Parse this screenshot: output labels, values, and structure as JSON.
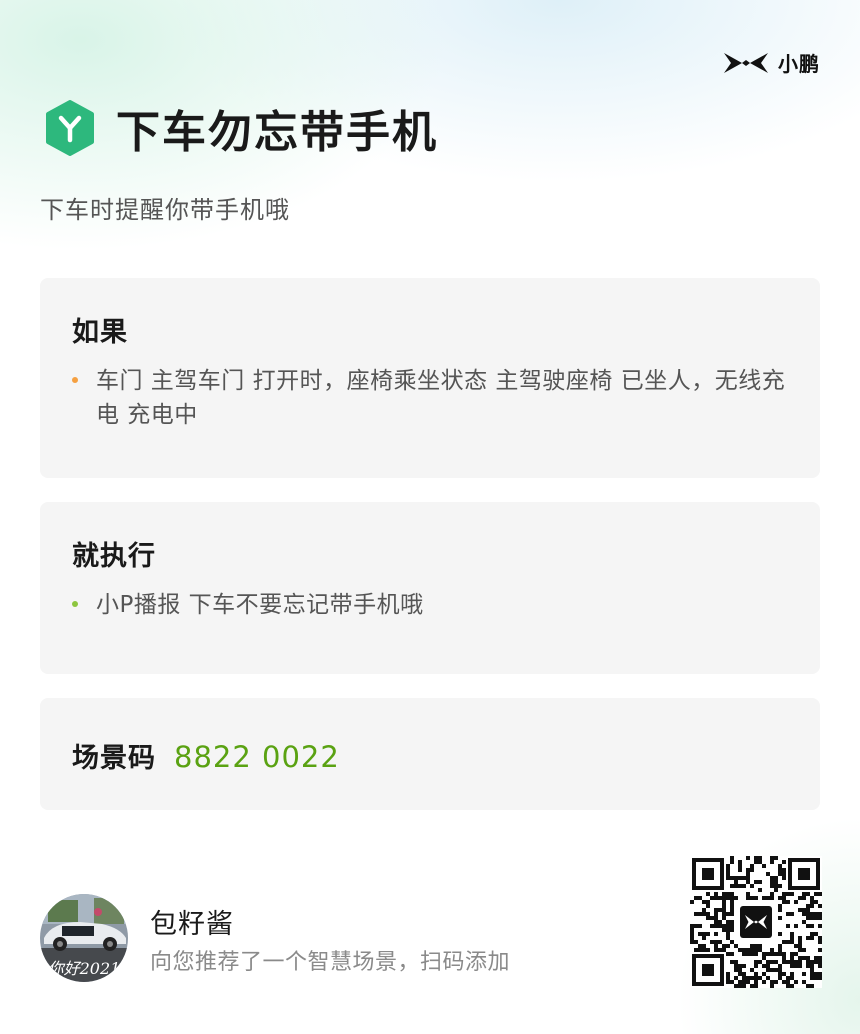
{
  "brand": {
    "name": "小鹏"
  },
  "header": {
    "title": "下车勿忘带手机",
    "subtitle": "下车时提醒你带手机哦",
    "icon_color": "#2db87d"
  },
  "condition": {
    "heading": "如果",
    "item": "车门 主驾车门 打开时，座椅乘坐状态 主驾驶座椅 已坐人，无线充电 充电中"
  },
  "action": {
    "heading": "就执行",
    "item": "小P播报 下车不要忘记带手机哦"
  },
  "scene_code": {
    "label": "场景码",
    "value": "8822 0022",
    "value_color": "#5aa212"
  },
  "recommender": {
    "name": "包籽酱",
    "description": "向您推荐了一个智慧场景，扫码添加",
    "avatar_caption": "你好2021"
  },
  "icons": [
    "xpeng-logo-icon",
    "scene-hexagon-icon",
    "qr-code"
  ]
}
